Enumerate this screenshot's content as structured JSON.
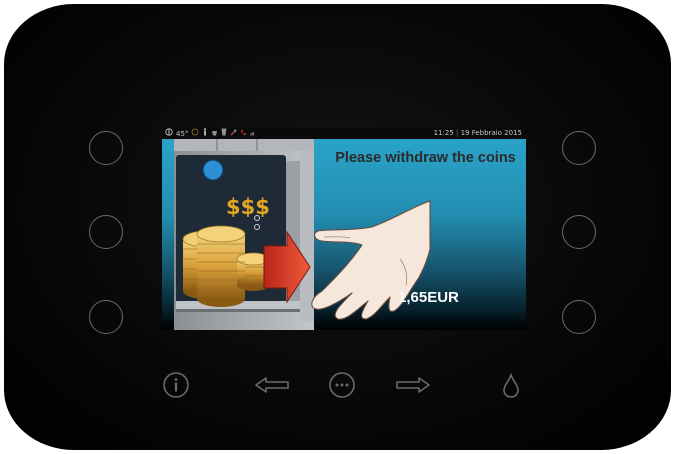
{
  "status_bar": {
    "temperature": "45°",
    "time": "11:25",
    "separator": "|",
    "date": "19 Febbraio 2015"
  },
  "screen": {
    "message": "Please withdraw the coins",
    "amount": "1,65EUR",
    "illustration_label": "$$$"
  },
  "icons": {
    "side_left": [
      "side-button",
      "side-button",
      "side-button"
    ],
    "side_right": [
      "side-button",
      "side-button",
      "side-button"
    ],
    "bottom": [
      "info-icon",
      "arrow-left-icon",
      "menu-dots-icon",
      "arrow-right-icon",
      "drop-icon"
    ]
  },
  "colors": {
    "screen_top": "#2aa3c9",
    "screen_bottom": "#000000",
    "refund_arrow": "#e5432a",
    "coin_gold": "#d9a03a",
    "dollar_gold": "#e0a820",
    "icon_gray": "#6a6a6a"
  }
}
